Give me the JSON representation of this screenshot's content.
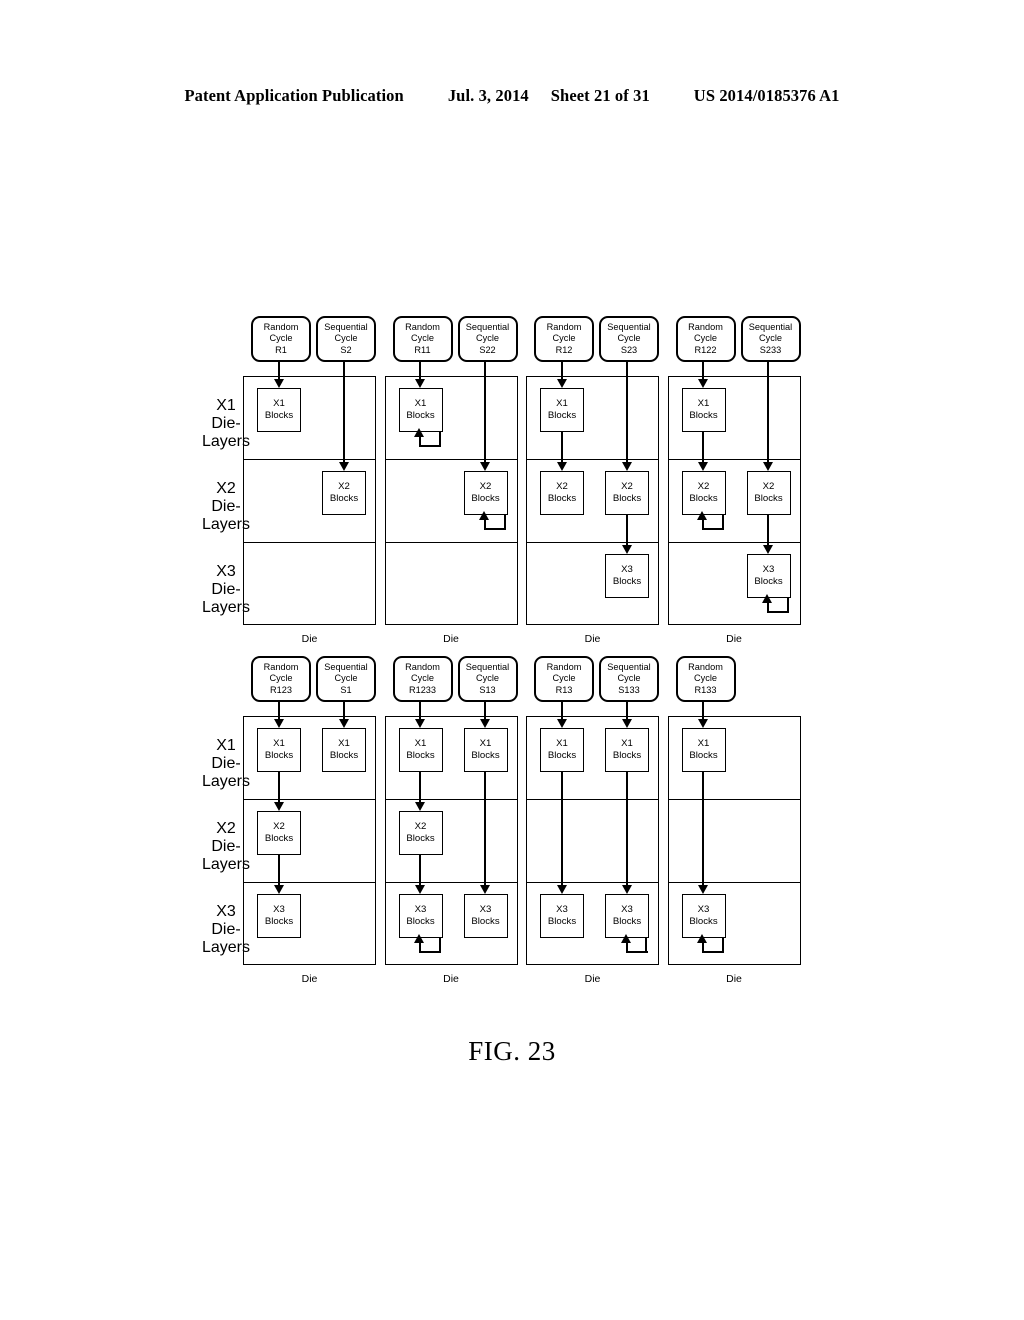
{
  "header": {
    "title": "Patent Application Publication",
    "date": "Jul. 3, 2014",
    "sheet": "Sheet 21 of 31",
    "patent_number": "US 2014/0185376 A1"
  },
  "figure": {
    "caption": "FIG. 23",
    "die_caption": "Die",
    "layer_labels": [
      {
        "line1": "X1",
        "line2": "Die-",
        "line3": "Layers"
      },
      {
        "line1": "X2",
        "line2": "Die-",
        "line3": "Layers"
      },
      {
        "line1": "X3",
        "line2": "Die-",
        "line3": "Layers"
      }
    ],
    "block_labels": {
      "x1": {
        "line1": "X1",
        "line2": "Blocks"
      },
      "x2": {
        "line1": "X2",
        "line2": "Blocks"
      },
      "x3": {
        "line1": "X3",
        "line2": "Blocks"
      }
    },
    "cycle_kind": {
      "random": "Random",
      "sequential": "Sequential",
      "cycle": "Cycle"
    },
    "rows": [
      {
        "dies": [
          {
            "cycles": [
              {
                "kind": "Random",
                "word2": "Cycle",
                "id": "R1",
                "column": "left"
              },
              {
                "kind": "Sequential",
                "word2": "Cycle",
                "id": "S2",
                "column": "right"
              }
            ],
            "blocks": [
              {
                "column": "left",
                "layer": "x1",
                "label1": "X1",
                "label2": "Blocks",
                "loop": false
              },
              {
                "column": "right",
                "layer": "x2",
                "label1": "X2",
                "label2": "Blocks",
                "loop": false
              }
            ]
          },
          {
            "cycles": [
              {
                "kind": "Random",
                "word2": "Cycle",
                "id": "R11",
                "column": "left"
              },
              {
                "kind": "Sequential",
                "word2": "Cycle",
                "id": "S22",
                "column": "right"
              }
            ],
            "blocks": [
              {
                "column": "left",
                "layer": "x1",
                "label1": "X1",
                "label2": "Blocks",
                "loop": true
              },
              {
                "column": "right",
                "layer": "x2",
                "label1": "X2",
                "label2": "Blocks",
                "loop": true
              }
            ]
          },
          {
            "cycles": [
              {
                "kind": "Random",
                "word2": "Cycle",
                "id": "R12",
                "column": "left"
              },
              {
                "kind": "Sequential",
                "word2": "Cycle",
                "id": "S23",
                "column": "right"
              }
            ],
            "blocks": [
              {
                "column": "left",
                "layer": "x1",
                "label1": "X1",
                "label2": "Blocks",
                "loop": false
              },
              {
                "column": "left",
                "layer": "x2",
                "label1": "X2",
                "label2": "Blocks",
                "loop": false
              },
              {
                "column": "right",
                "layer": "x2",
                "label1": "X2",
                "label2": "Blocks",
                "loop": false
              },
              {
                "column": "right",
                "layer": "x3",
                "label1": "X3",
                "label2": "Blocks",
                "loop": false
              }
            ]
          },
          {
            "cycles": [
              {
                "kind": "Random",
                "word2": "Cycle",
                "id": "R122",
                "column": "left"
              },
              {
                "kind": "Sequential",
                "word2": "Cycle",
                "id": "S233",
                "column": "right"
              }
            ],
            "blocks": [
              {
                "column": "left",
                "layer": "x1",
                "label1": "X1",
                "label2": "Blocks",
                "loop": false
              },
              {
                "column": "left",
                "layer": "x2",
                "label1": "X2",
                "label2": "Blocks",
                "loop": true
              },
              {
                "column": "right",
                "layer": "x2",
                "label1": "X2",
                "label2": "Blocks",
                "loop": false
              },
              {
                "column": "right",
                "layer": "x3",
                "label1": "X3",
                "label2": "Blocks",
                "loop": true
              }
            ]
          }
        ]
      },
      {
        "dies": [
          {
            "cycles": [
              {
                "kind": "Random",
                "word2": "Cycle",
                "id": "R123",
                "column": "left"
              },
              {
                "kind": "Sequential",
                "word2": "Cycle",
                "id": "S1",
                "column": "right"
              }
            ],
            "blocks": [
              {
                "column": "left",
                "layer": "x1",
                "label1": "X1",
                "label2": "Blocks",
                "loop": false
              },
              {
                "column": "left",
                "layer": "x2",
                "label1": "X2",
                "label2": "Blocks",
                "loop": false
              },
              {
                "column": "left",
                "layer": "x3",
                "label1": "X3",
                "label2": "Blocks",
                "loop": false
              },
              {
                "column": "right",
                "layer": "x1",
                "label1": "X1",
                "label2": "Blocks",
                "loop": false
              }
            ]
          },
          {
            "cycles": [
              {
                "kind": "Random",
                "word2": "Cycle",
                "id": "R1233",
                "column": "left"
              },
              {
                "kind": "Sequential",
                "word2": "Cycle",
                "id": "S13",
                "column": "right"
              }
            ],
            "blocks": [
              {
                "column": "left",
                "layer": "x1",
                "label1": "X1",
                "label2": "Blocks",
                "loop": false
              },
              {
                "column": "left",
                "layer": "x2",
                "label1": "X2",
                "label2": "Blocks",
                "loop": false
              },
              {
                "column": "left",
                "layer": "x3",
                "label1": "X3",
                "label2": "Blocks",
                "loop": true
              },
              {
                "column": "right",
                "layer": "x1",
                "label1": "X1",
                "label2": "Blocks",
                "loop": false
              },
              {
                "column": "right",
                "layer": "x3",
                "label1": "X3",
                "label2": "Blocks",
                "loop": false
              }
            ]
          },
          {
            "cycles": [
              {
                "kind": "Random",
                "word2": "Cycle",
                "id": "R13",
                "column": "left"
              },
              {
                "kind": "Sequential",
                "word2": "Cycle",
                "id": "S133",
                "column": "right"
              }
            ],
            "blocks": [
              {
                "column": "left",
                "layer": "x1",
                "label1": "X1",
                "label2": "Blocks",
                "loop": false
              },
              {
                "column": "left",
                "layer": "x3",
                "label1": "X3",
                "label2": "Blocks",
                "loop": false
              },
              {
                "column": "right",
                "layer": "x1",
                "label1": "X1",
                "label2": "Blocks",
                "loop": false
              },
              {
                "column": "right",
                "layer": "x3",
                "label1": "X3",
                "label2": "Blocks",
                "loop": true
              }
            ]
          },
          {
            "cycles": [
              {
                "kind": "Random",
                "word2": "Cycle",
                "id": "R133",
                "column": "left"
              }
            ],
            "blocks": [
              {
                "column": "left",
                "layer": "x1",
                "label1": "X1",
                "label2": "Blocks",
                "loop": false
              },
              {
                "column": "left",
                "layer": "x3",
                "label1": "X3",
                "label2": "Blocks",
                "loop": true
              }
            ]
          }
        ]
      }
    ]
  }
}
